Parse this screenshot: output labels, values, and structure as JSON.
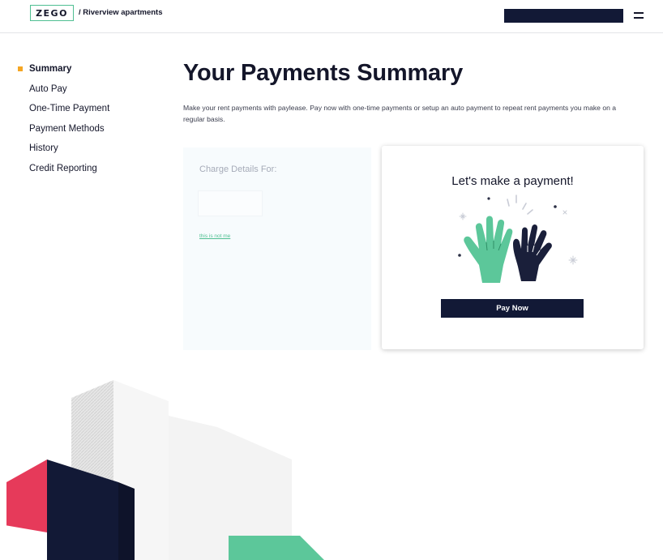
{
  "header": {
    "logo_text": "ZEGO",
    "breadcrumb": "/ Riverview apartments"
  },
  "sidebar": {
    "items": [
      {
        "label": "Summary",
        "active": true
      },
      {
        "label": "Auto Pay",
        "active": false
      },
      {
        "label": "One-Time Payment",
        "active": false
      },
      {
        "label": "Payment Methods",
        "active": false
      },
      {
        "label": "History",
        "active": false
      },
      {
        "label": "Credit Reporting",
        "active": false
      }
    ]
  },
  "main": {
    "title": "Your Payments Summary",
    "intro": "Make your rent payments with paylease. Pay now with one-time payments or setup an auto payment to repeat rent payments you make on a regular basis.",
    "charge_details": {
      "title": "Charge Details For:",
      "not_me_link": "this is not me"
    },
    "payment_card": {
      "title": "Let's make a payment!",
      "button_label": "Pay Now",
      "illustration": "high-five-hands"
    }
  },
  "colors": {
    "navy": "#121936",
    "accent_green": "#5cc79a",
    "accent_orange": "#f5a623",
    "accent_red": "#e63a5a",
    "text": "#14162a"
  }
}
